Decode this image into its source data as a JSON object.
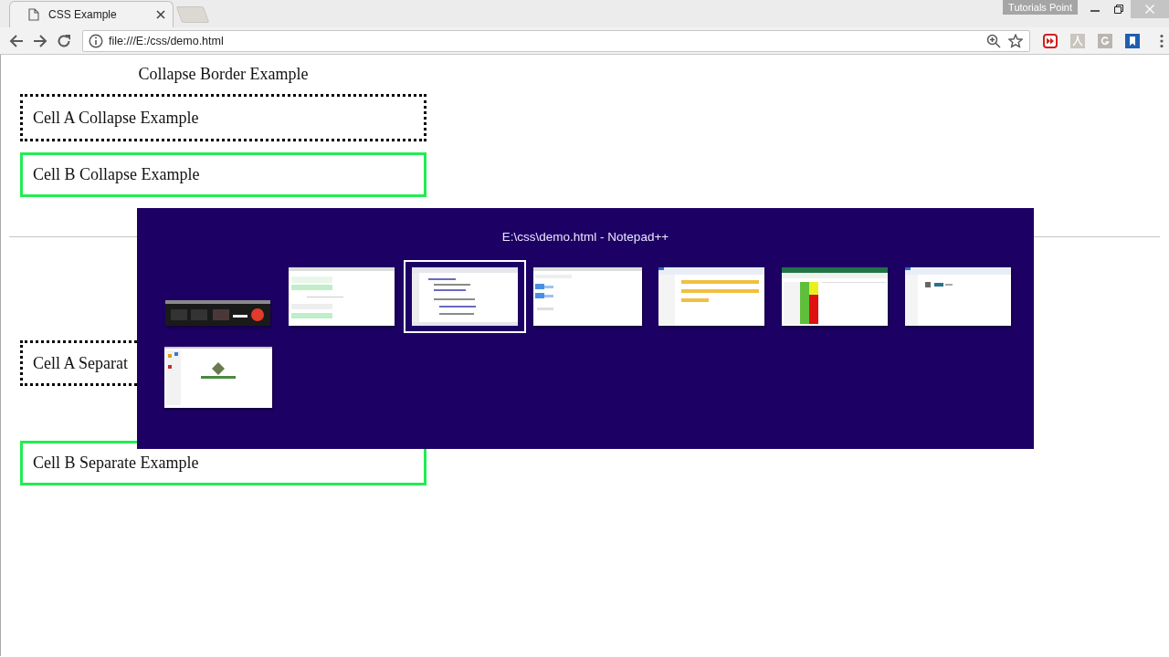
{
  "browser": {
    "tab": {
      "title": "CSS Example",
      "selected": true
    },
    "profile": "Tutorials Point",
    "address": "file:///E:/css/demo.html"
  },
  "page": {
    "tables": [
      {
        "caption": "Collapse Border Example",
        "cells": [
          {
            "text": "Cell A Collapse Example",
            "kind": "dotted"
          },
          {
            "text": "Cell B Collapse Example",
            "kind": "solid"
          }
        ]
      },
      {
        "cells": [
          {
            "text": "Cell A Separat",
            "kind": "dotted"
          },
          {
            "text": "Cell B Separate Example",
            "kind": "solid"
          }
        ]
      }
    ]
  },
  "switcher": {
    "title": "E:\\css\\demo.html - Notepad++",
    "windows": [
      {
        "kind": "picture",
        "selected": false
      },
      {
        "kind": "picture",
        "selected": false
      },
      {
        "kind": "picture",
        "selected": true
      },
      {
        "kind": "picture",
        "selected": false
      },
      {
        "kind": "picture",
        "selected": false
      },
      {
        "kind": "picture",
        "selected": false
      },
      {
        "kind": "picture",
        "selected": false
      },
      {
        "kind": "picture",
        "selected": false
      }
    ]
  }
}
